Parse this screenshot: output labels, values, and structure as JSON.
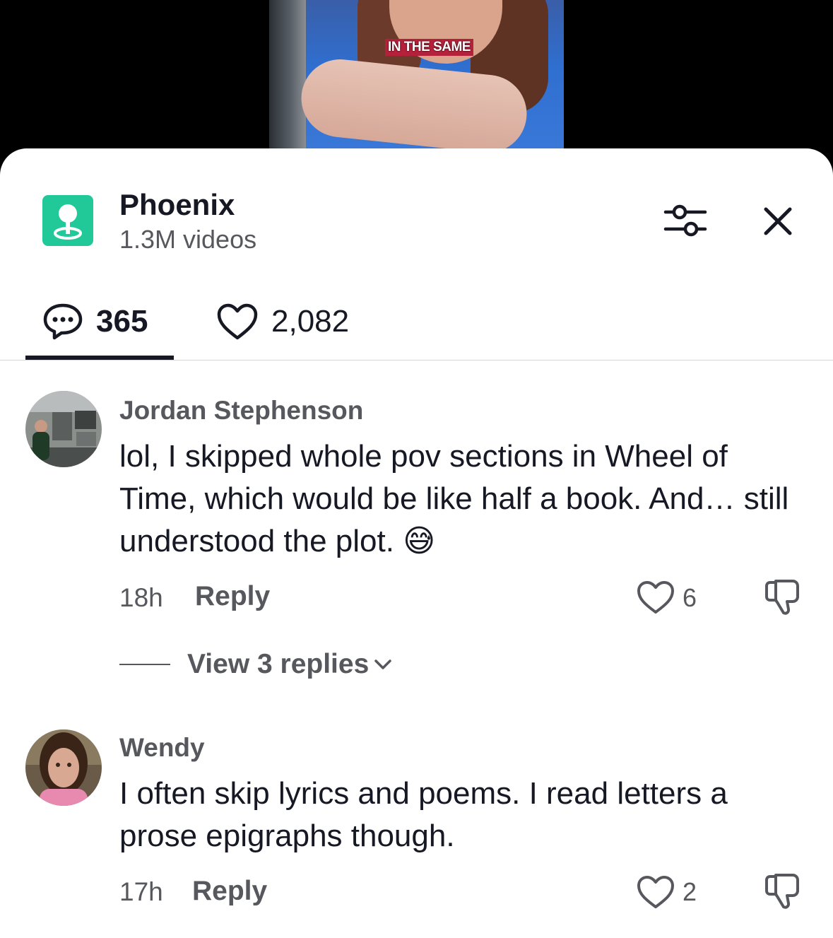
{
  "video": {
    "caption": "IN THE SAME"
  },
  "header": {
    "title": "Phoenix",
    "subtitle": "1.3M videos",
    "location_icon": "location-pin-icon",
    "filter_icon": "sliders-icon",
    "close_icon": "close-icon",
    "accent_color": "#20c997"
  },
  "tabs": [
    {
      "icon": "comment-bubble-icon",
      "count": "365",
      "active": true
    },
    {
      "icon": "heart-outline-icon",
      "count": "2,082",
      "active": false
    }
  ],
  "comments": [
    {
      "author": "Jordan Stephenson",
      "text": "lol, I skipped whole pov sections in Wheel of Time, which would be like half a book. And… still understood the plot.",
      "emoji": "😅",
      "time": "18h",
      "reply_label": "Reply",
      "likes": "6",
      "view_replies": "View 3 replies"
    },
    {
      "author": "Wendy",
      "text": "I often skip lyrics and poems. I read letters a prose epigraphs though.",
      "time": "17h",
      "reply_label": "Reply",
      "likes": "2"
    }
  ]
}
